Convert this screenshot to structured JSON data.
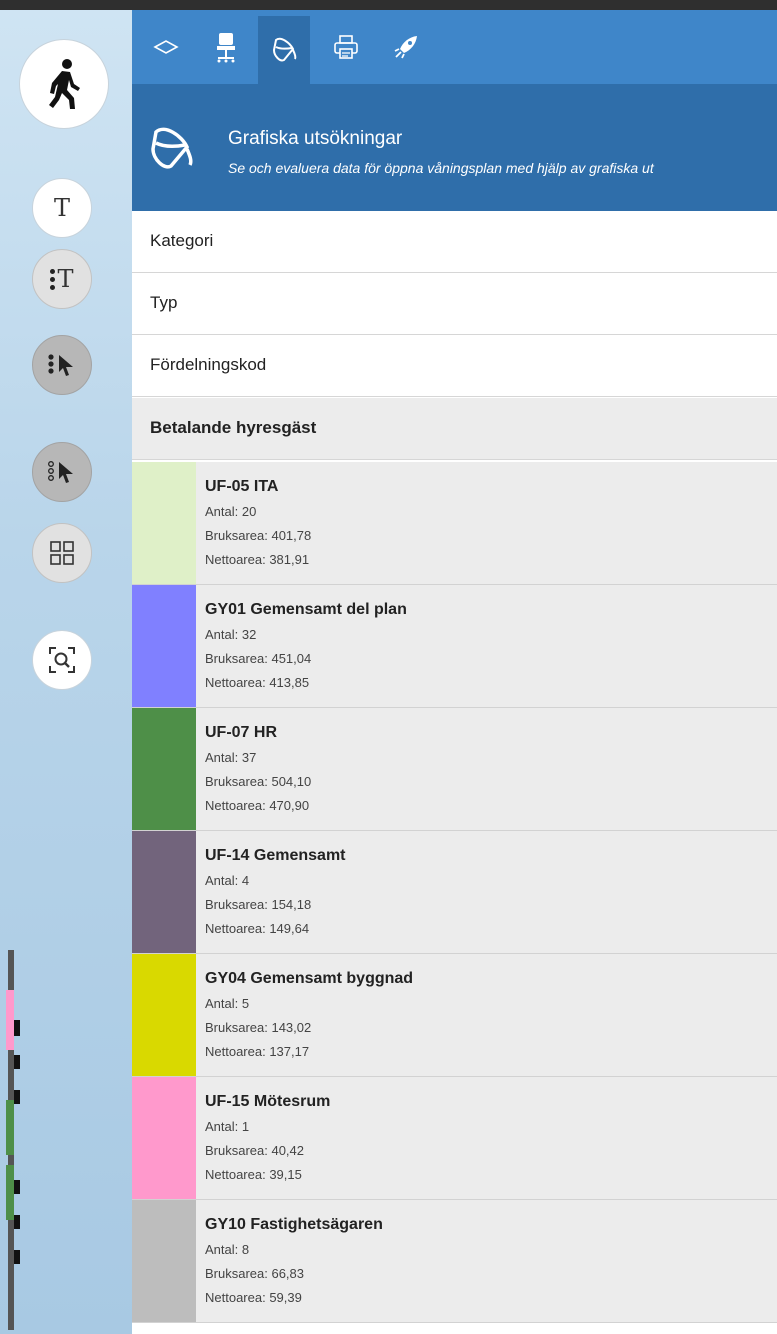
{
  "tabs": [
    {
      "icon": "diamond-outline-icon"
    },
    {
      "icon": "office-chair-icon"
    },
    {
      "icon": "paint-bucket-icon",
      "active": true
    },
    {
      "icon": "printer-icon"
    },
    {
      "icon": "rocket-icon"
    }
  ],
  "header": {
    "title": "Grafiska utsökningar",
    "subtitle": "Se och evaluera data för öppna våningsplan med hjälp av grafiska ut",
    "icon": "paint-bucket-icon"
  },
  "tools": [
    {
      "icon": "walking-person-icon"
    },
    {
      "icon": "text-icon",
      "label": "T"
    },
    {
      "icon": "text-list-icon",
      "label": "T"
    },
    {
      "icon": "select-list-icon"
    },
    {
      "icon": "select-outline-icon"
    },
    {
      "icon": "grid-icon"
    },
    {
      "icon": "zoom-search-icon"
    }
  ],
  "accordion": [
    {
      "label": "Kategori"
    },
    {
      "label": "Typ"
    },
    {
      "label": "Fördelningskod"
    },
    {
      "label": "Betalande hyresgäst"
    }
  ],
  "items": [
    {
      "name": "UF-05 ITA",
      "antal": "Antal: 20",
      "bruksarea": "Bruksarea: 401,78",
      "nettoarea": "Nettoarea: 381,91",
      "color": "#dff0c8"
    },
    {
      "name": "GY01 Gemensamt del plan",
      "antal": "Antal: 32",
      "bruksarea": "Bruksarea: 451,04",
      "nettoarea": "Nettoarea: 413,85",
      "color": "#8080ff"
    },
    {
      "name": "UF-07 HR",
      "antal": "Antal: 37",
      "bruksarea": "Bruksarea: 504,10",
      "nettoarea": "Nettoarea: 470,90",
      "color": "#4e8f48"
    },
    {
      "name": "UF-14 Gemensamt",
      "antal": "Antal: 4",
      "bruksarea": "Bruksarea: 154,18",
      "nettoarea": "Nettoarea: 149,64",
      "color": "#72647c"
    },
    {
      "name": "GY04 Gemensamt byggnad",
      "antal": "Antal: 5",
      "bruksarea": "Bruksarea: 143,02",
      "nettoarea": "Nettoarea: 137,17",
      "color": "#d9d900"
    },
    {
      "name": "UF-15 Mötesrum",
      "antal": "Antal: 1",
      "bruksarea": "Bruksarea: 40,42",
      "nettoarea": "Nettoarea: 39,15",
      "color": "#ff99cc"
    },
    {
      "name": "GY10 Fastighetsägaren",
      "antal": "Antal: 8",
      "bruksarea": "Bruksarea: 66,83",
      "nettoarea": "Nettoarea: 59,39",
      "color": "#bdbdbd"
    }
  ]
}
